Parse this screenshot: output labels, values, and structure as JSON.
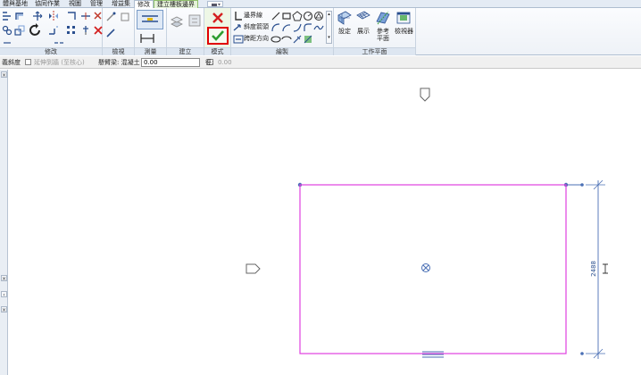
{
  "tabs": [
    {
      "label": "體與基地"
    },
    {
      "label": "協同作業"
    },
    {
      "label": "視圖"
    },
    {
      "label": "管理"
    },
    {
      "label": "增益集"
    },
    {
      "label": "修改",
      "active": true
    },
    {
      "label": "建立樓板邊界",
      "context": true
    }
  ],
  "panels": {
    "modify": "修改",
    "view": "檢視",
    "measure": "測量",
    "create": "建立",
    "mode": "模式",
    "draw": "繪製",
    "workplane": "工作平面"
  },
  "draw_tools": {
    "boundary_line": "邊界線",
    "slope_arrow": "斜度箭頭",
    "span_direction": "跨距方向"
  },
  "workplane_tools": {
    "set": "設定",
    "show": "展示",
    "ref_plane": "參考平面",
    "viewer": "檢視器"
  },
  "options_bar": {
    "lead_label": "義斜度",
    "extend_checkbox": "延伸到牆 (至核心)",
    "offset_label": "偏移",
    "offset_value": "0.00",
    "offset_prefix_label": "懸臂梁: 混凝土",
    "radius_label": "徑:",
    "radius_value": "0.00"
  },
  "canvas": {
    "dimension_text": "2488"
  },
  "colors": {
    "boundary": "#e040e0",
    "reference": "#4a6fb5",
    "accent_green": "#2f9e2f",
    "cancel_red": "#d42020",
    "highlight_box": "#e00000"
  }
}
